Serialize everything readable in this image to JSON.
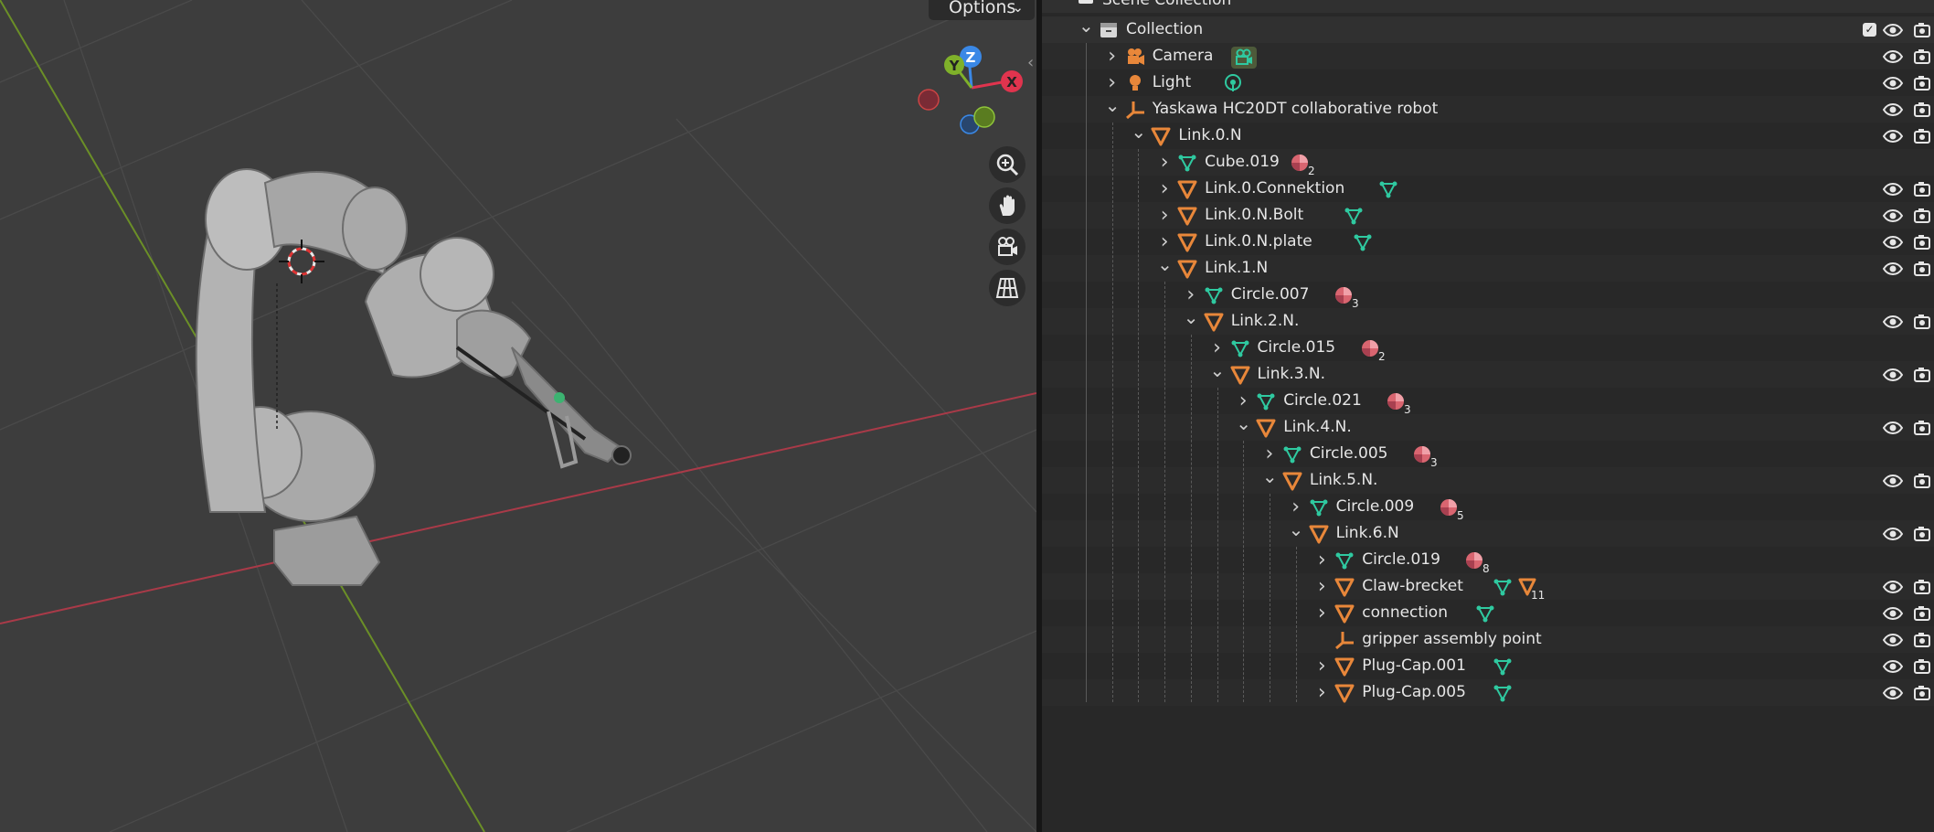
{
  "viewport": {
    "options_label": "Options",
    "gizmo": {
      "x_label": "X",
      "y_label": "Y",
      "z_label": "Z"
    },
    "nav_buttons": [
      "zoom-icon",
      "hand-icon",
      "camera-icon",
      "grid-icon"
    ]
  },
  "outliner": {
    "scene_collection_label": "Scene Collection",
    "rows": [
      {
        "label": "Collection",
        "icon": "collection-icon"
      },
      {
        "label": "Camera",
        "icon": "camera-object-icon"
      },
      {
        "label": "Light",
        "icon": "light-object-icon"
      },
      {
        "label": "Yaskawa HC20DT collaborative robot",
        "icon": "empty-icon"
      },
      {
        "label": "Link.0.N",
        "icon": "mesh-object-icon"
      },
      {
        "label": "Cube.019",
        "icon": "mesh-data-icon",
        "badge": "2"
      },
      {
        "label": "Link.0.Connektion",
        "icon": "mesh-object-icon"
      },
      {
        "label": "Link.0.N.Bolt",
        "icon": "mesh-object-icon"
      },
      {
        "label": "Link.0.N.plate",
        "icon": "mesh-object-icon"
      },
      {
        "label": "Link.1.N",
        "icon": "mesh-object-icon"
      },
      {
        "label": "Circle.007",
        "icon": "mesh-data-icon",
        "badge": "3"
      },
      {
        "label": "Link.2.N.",
        "icon": "mesh-object-icon"
      },
      {
        "label": "Circle.015",
        "icon": "mesh-data-icon",
        "badge": "2"
      },
      {
        "label": "Link.3.N.",
        "icon": "mesh-object-icon"
      },
      {
        "label": "Circle.021",
        "icon": "mesh-data-icon",
        "badge": "3"
      },
      {
        "label": "Link.4.N.",
        "icon": "mesh-object-icon"
      },
      {
        "label": "Circle.005",
        "icon": "mesh-data-icon",
        "badge": "3"
      },
      {
        "label": "Link.5.N.",
        "icon": "mesh-object-icon"
      },
      {
        "label": "Circle.009",
        "icon": "mesh-data-icon",
        "badge": "5"
      },
      {
        "label": "Link.6.N",
        "icon": "mesh-object-icon"
      },
      {
        "label": "Circle.019",
        "icon": "mesh-data-icon",
        "badge": "8"
      },
      {
        "label": "Claw-brecket",
        "icon": "mesh-object-icon",
        "badge": "11"
      },
      {
        "label": "connection",
        "icon": "mesh-object-icon"
      },
      {
        "label": "gripper assembly point",
        "icon": "empty-icon"
      },
      {
        "label": "Plug-Cap.001",
        "icon": "mesh-object-icon"
      },
      {
        "label": "Plug-Cap.005",
        "icon": "mesh-object-icon"
      }
    ]
  },
  "colors": {
    "viewport_bg": "#3d3d3d",
    "outliner_bg": "#282828",
    "object_orange": "#e8873a",
    "mesh_green": "#2fc9a0",
    "material_red": "#d96570",
    "axis_x": "#e0344e",
    "axis_y": "#7fb12a",
    "axis_z": "#3a88e6"
  }
}
